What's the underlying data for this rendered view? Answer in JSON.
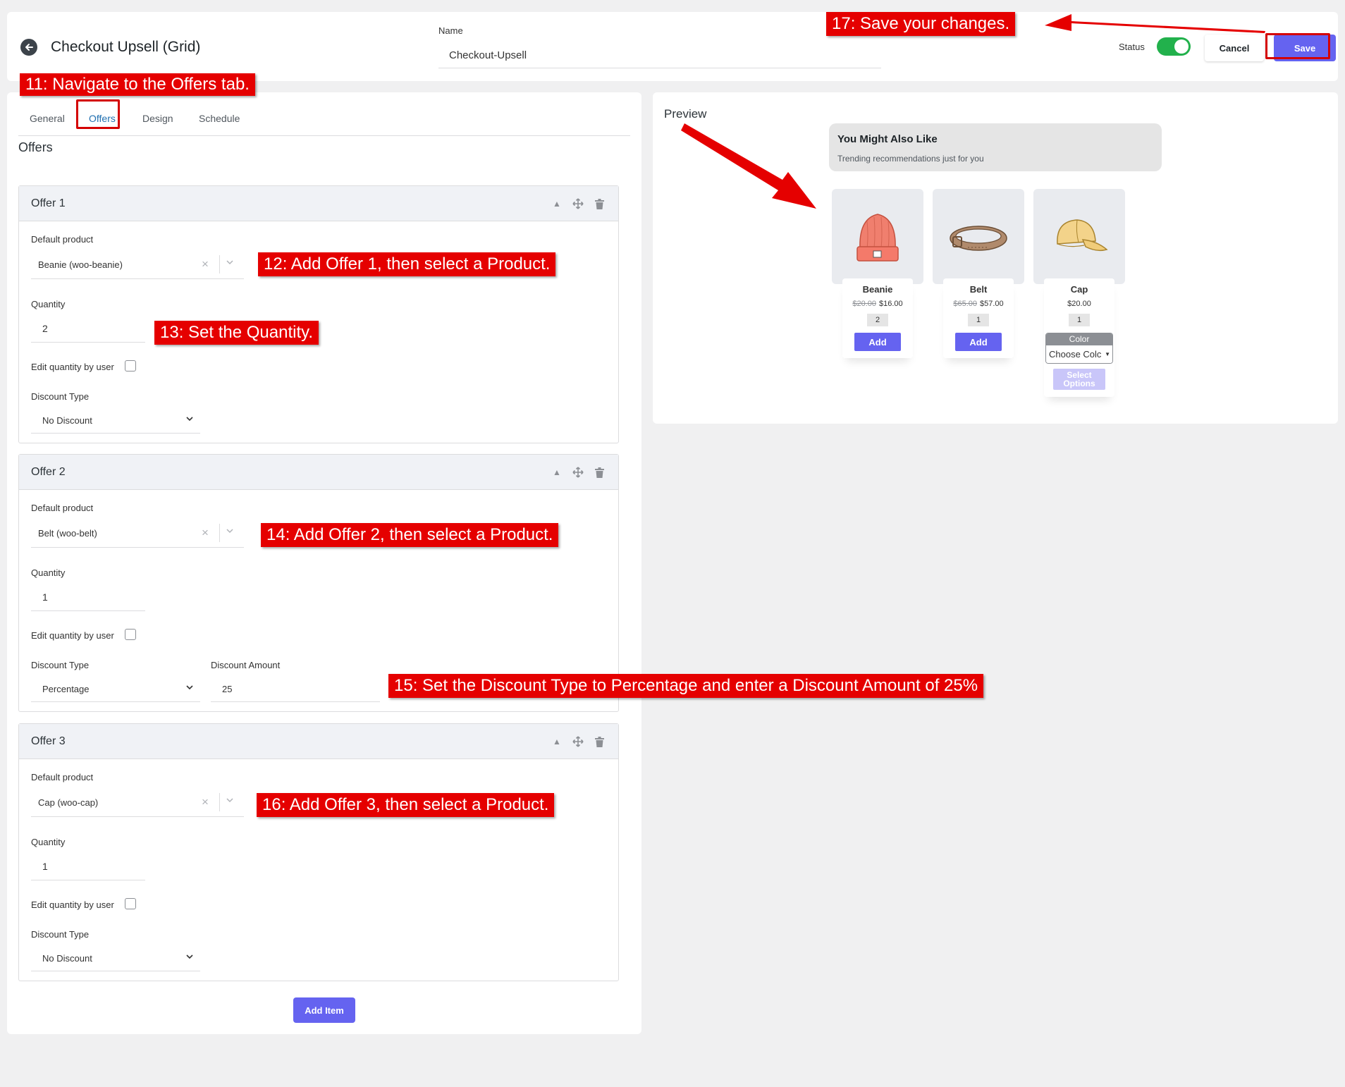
{
  "header": {
    "title": "Checkout Upsell (Grid)",
    "name_label": "Name",
    "name_value": "Checkout-Upsell",
    "status_label": "Status",
    "status_on": true,
    "cancel_label": "Cancel",
    "save_label": "Save"
  },
  "tabs": [
    "General",
    "Offers",
    "Design",
    "Schedule"
  ],
  "active_tab": "Offers",
  "section_title": "Offers",
  "offers": [
    {
      "title": "Offer 1",
      "default_product_label": "Default product",
      "product": "Beanie (woo-beanie)",
      "quantity_label": "Quantity",
      "quantity": "2",
      "edit_qty_label": "Edit quantity by user",
      "discount_type_label": "Discount Type",
      "discount_type": "No Discount"
    },
    {
      "title": "Offer 2",
      "default_product_label": "Default product",
      "product": "Belt (woo-belt)",
      "quantity_label": "Quantity",
      "quantity": "1",
      "edit_qty_label": "Edit quantity by user",
      "discount_type_label": "Discount Type",
      "discount_type": "Percentage",
      "discount_amount_label": "Discount Amount",
      "discount_amount": "25"
    },
    {
      "title": "Offer 3",
      "default_product_label": "Default product",
      "product": "Cap (woo-cap)",
      "quantity_label": "Quantity",
      "quantity": "1",
      "edit_qty_label": "Edit quantity by user",
      "discount_type_label": "Discount Type",
      "discount_type": "No Discount"
    }
  ],
  "add_item_label": "Add Item",
  "preview": {
    "label": "Preview",
    "title": "You Might Also Like",
    "subtitle": "Trending recommendations just for you",
    "products": [
      {
        "name": "Beanie",
        "old_price": "$20.00",
        "price": "$16.00",
        "qty": "2",
        "button": "Add"
      },
      {
        "name": "Belt",
        "old_price": "$65.00",
        "price": "$57.00",
        "qty": "1",
        "button": "Add"
      },
      {
        "name": "Cap",
        "old_price": "",
        "price": "$20.00",
        "qty": "1",
        "color_label": "Color",
        "color_placeholder": "Choose Colc",
        "button": "Select Options"
      }
    ]
  },
  "annotations": {
    "a11": "11: Navigate to the Offers tab.",
    "a12": "12: Add Offer 1, then select a Product.",
    "a13": "13: Set the Quantity.",
    "a14": "14: Add Offer 2, then select a Product.",
    "a15": "15: Set the Discount Type to Percentage and enter a Discount Amount of 25%",
    "a16": "16: Add Offer 3, then select a Product.",
    "a17": "17: Save your changes."
  },
  "colors": {
    "accent": "#6563f0",
    "toggle_on": "#22b14c",
    "annotation_red": "#e50000",
    "active_tab": "#2271b1"
  }
}
